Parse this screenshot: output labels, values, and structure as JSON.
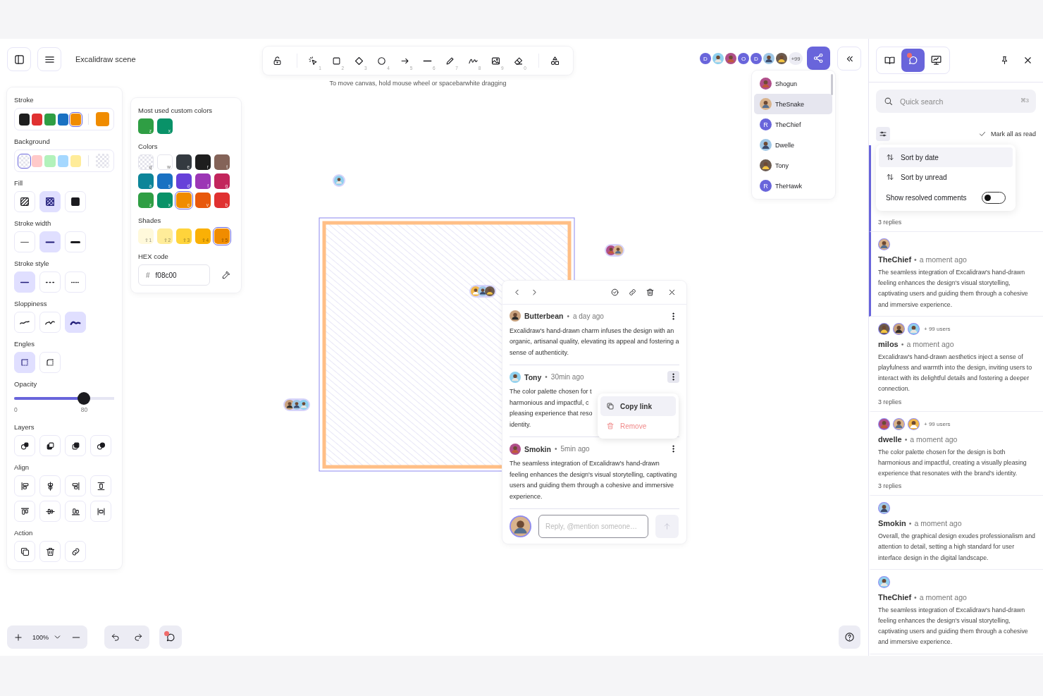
{
  "header": {
    "title": "Excalidraw scene"
  },
  "toolbar": {
    "tools": [
      {
        "shortcut": "1"
      },
      {
        "shortcut": "2"
      },
      {
        "shortcut": "3"
      },
      {
        "shortcut": "4"
      },
      {
        "shortcut": "5"
      },
      {
        "shortcut": "6"
      },
      {
        "shortcut": "7"
      },
      {
        "shortcut": "8"
      },
      {
        "shortcut": "9"
      },
      {
        "shortcut": "0"
      }
    ],
    "hint": "To move canvas, hold mouse wheel or spacebarwhite dragging"
  },
  "collaborators": {
    "avatars": [
      {
        "kind": "letter",
        "letter": "D"
      },
      {
        "kind": "photo"
      },
      {
        "kind": "photo"
      },
      {
        "kind": "letter",
        "letter": "O"
      },
      {
        "kind": "letter",
        "letter": "D"
      },
      {
        "kind": "photo"
      },
      {
        "kind": "photo"
      }
    ],
    "more": "+99",
    "list": [
      {
        "name": "Shogun",
        "kind": "photo",
        "selected": false
      },
      {
        "name": "TheSnake",
        "kind": "photo",
        "selected": true
      },
      {
        "name": "TheChief",
        "kind": "letter",
        "letter": "R",
        "selected": false
      },
      {
        "name": "Dwelle",
        "kind": "photo",
        "selected": false
      },
      {
        "name": "Tony",
        "kind": "photo",
        "selected": false
      },
      {
        "name": "TheHawk",
        "kind": "letter",
        "letter": "R",
        "selected": false
      }
    ]
  },
  "properties": {
    "stroke": {
      "label": "Stroke",
      "swatches": [
        {
          "color": "#1e1e1e",
          "selected": false
        },
        {
          "color": "#e03131",
          "selected": false
        },
        {
          "color": "#2f9e44",
          "selected": false
        },
        {
          "color": "#1971c2",
          "selected": false
        },
        {
          "color": "#f08c00",
          "selected": true
        }
      ],
      "current": {
        "color": "#f08c00"
      }
    },
    "background": {
      "label": "Background",
      "swatches": [
        {
          "kind": "transparent",
          "selected": true
        },
        {
          "kind": "color",
          "color": "#ffc9c9",
          "selected": false
        },
        {
          "kind": "color",
          "color": "#b2f2bb",
          "selected": false
        },
        {
          "kind": "color",
          "color": "#a5d8ff",
          "selected": false
        },
        {
          "kind": "color",
          "color": "#ffec99",
          "selected": false
        }
      ],
      "current": {
        "kind": "transparent"
      }
    },
    "fill": {
      "label": "Fill",
      "options": [
        {
          "selected": false
        },
        {
          "selected": true
        },
        {
          "selected": false
        }
      ]
    },
    "stroke_width": {
      "label": "Stroke width",
      "options": [
        {
          "selected": false
        },
        {
          "selected": true
        },
        {
          "selected": false
        }
      ]
    },
    "stroke_style": {
      "label": "Stroke style",
      "options": [
        {
          "selected": true
        },
        {
          "selected": false
        },
        {
          "selected": false
        }
      ]
    },
    "sloppiness": {
      "label": "Sloppiness",
      "options": [
        {
          "selected": false
        },
        {
          "selected": false
        },
        {
          "selected": true
        }
      ]
    },
    "edges": {
      "label": "Engles",
      "options": [
        {
          "selected": true
        },
        {
          "selected": false
        }
      ]
    },
    "opacity": {
      "label": "Opacity",
      "level": 0.7,
      "min": "0",
      "value": "80"
    },
    "layers": {
      "label": "Layers"
    },
    "align": {
      "label": "Align"
    },
    "action": {
      "label": "Action"
    }
  },
  "color_picker": {
    "custom_title": "Most used custom colors",
    "custom": [
      {
        "color": "#2f9e44",
        "key": "z"
      },
      {
        "color": "#099268",
        "key": "x"
      }
    ],
    "colors_title": "Colors",
    "colors": [
      {
        "kind": "transparent",
        "key": "q",
        "selected": false
      },
      {
        "kind": "color",
        "color": "#ffffff",
        "key": "w",
        "selected": false
      },
      {
        "kind": "color",
        "color": "#343a40",
        "key": "e",
        "selected": false
      },
      {
        "kind": "color",
        "color": "#1e1e1e",
        "key": "r",
        "selected": false
      },
      {
        "kind": "color",
        "color": "#846358",
        "key": "t",
        "selected": false
      },
      {
        "kind": "color",
        "color": "#0c8599",
        "key": "a",
        "selected": false
      },
      {
        "kind": "color",
        "color": "#1971c2",
        "key": "s",
        "selected": false
      },
      {
        "kind": "color",
        "color": "#6741d9",
        "key": "d",
        "selected": false
      },
      {
        "kind": "color",
        "color": "#9c36b5",
        "key": "f",
        "selected": false
      },
      {
        "kind": "color",
        "color": "#c2255c",
        "key": "g",
        "selected": false
      },
      {
        "kind": "color",
        "color": "#2f9e44",
        "key": "z",
        "selected": false
      },
      {
        "kind": "color",
        "color": "#099268",
        "key": "x",
        "selected": false
      },
      {
        "kind": "color",
        "color": "#f08c00",
        "key": "c",
        "selected": true
      },
      {
        "kind": "color",
        "color": "#e8590c",
        "key": "v",
        "selected": false
      },
      {
        "kind": "color",
        "color": "#e03131",
        "key": "b",
        "selected": false
      }
    ],
    "shades_title": "Shades",
    "shades": [
      {
        "color": "#fff9db",
        "key": "⇧1",
        "selected": false
      },
      {
        "color": "#ffec99",
        "key": "⇧2",
        "selected": false
      },
      {
        "color": "#ffd43b",
        "key": "⇧3",
        "selected": false
      },
      {
        "color": "#fab005",
        "key": "⇧4",
        "selected": false
      },
      {
        "color": "#f08c00",
        "key": "⇧5",
        "selected": true
      }
    ],
    "hex_title": "HEX code",
    "hex_prefix": "#",
    "hex_value": "f08c00"
  },
  "comment_popup": {
    "comments": [
      {
        "author": "Butterbean",
        "separator": "•",
        "time": "a day ago",
        "menu_open": false,
        "text": "Excalidraw's hand-drawn charm infuses the design with an organic,  artisanal quality, elevating its appeal and fostering a sense of  authenticity."
      },
      {
        "author": "Tony",
        "separator": "•",
        "time": "30min ago",
        "menu_open": true,
        "lines": [
          "The color palette chosen for t",
          "harmonious and  impactful, c",
          "pleasing experience that reso",
          "identity."
        ]
      },
      {
        "author": "Smokin",
        "separator": "•",
        "time": "5min ago",
        "menu_open": false,
        "text": "The seamless integration of Excalidraw's hand-drawn feeling enhances the  design's visual storytelling, captivating users and guiding them  through a cohesive and immersive experience."
      }
    ],
    "menu": [
      {
        "label": "Copy link",
        "kind": "copy",
        "selected": true
      },
      {
        "label": "Remove",
        "kind": "danger",
        "selected": false
      }
    ],
    "reply": {
      "placeholder": "Reply, @mention someone…",
      "disabled": true
    }
  },
  "bottom_bar": {
    "zoom": "100%",
    "comments_unread": true
  },
  "sidebar": {
    "tabs": [
      {
        "selected": false,
        "unread": false
      },
      {
        "selected": true,
        "unread": true
      },
      {
        "selected": false,
        "unread": false
      }
    ],
    "search": {
      "placeholder": "Quick search",
      "shortcut": "⌘3"
    },
    "mark_all": "Mark all as read",
    "sort_menu": {
      "items": [
        {
          "label": "Sort by date",
          "selected": true
        },
        {
          "label": "Sort by unread",
          "selected": false
        }
      ],
      "toggle": {
        "label": "Show resolved comments",
        "on": false
      }
    },
    "threads": [
      {
        "selected": true,
        "replies": "3 replies"
      },
      {
        "selected": true,
        "avatars": [
          {
            "kind": "photo"
          }
        ],
        "author": "TheChief",
        "separator": "•",
        "time": "a moment ago",
        "text": "The seamless integration of Excalidraw's hand-drawn feeling enhances the  design's visual storytelling, captivating users and guiding them  through a cohesive and immersive experience."
      },
      {
        "selected": false,
        "avatars": [
          {
            "kind": "photo"
          },
          {
            "kind": "photo"
          },
          {
            "kind": "photo"
          }
        ],
        "more": "+ 99 users",
        "author": "milos",
        "separator": "•",
        "time": "a moment ago",
        "text": "Excalidraw's hand-drawn aesthetics inject a sense of playfulness and  warmth into the design, inviting users to interact with its delightful  details and fostering a deeper connection.",
        "replies": "3 replies"
      },
      {
        "selected": false,
        "avatars": [
          {
            "kind": "photo"
          },
          {
            "kind": "photo"
          },
          {
            "kind": "photo"
          }
        ],
        "more": "+ 99 users",
        "author": "dwelle",
        "separator": "•",
        "time": "a moment ago",
        "text": "The color palette chosen for the design is both harmonious and  impactful, creating a visually pleasing experience that resonates with  the brand's identity.",
        "replies": "3 replies"
      },
      {
        "selected": false,
        "avatars": [
          {
            "kind": "photo"
          }
        ],
        "author": "Smokin",
        "separator": "•",
        "time": "a moment ago",
        "text": "Overall, the graphical design exudes professionalism and attention to  detail, setting a high standard for user interface design in the digital  landscape."
      },
      {
        "selected": false,
        "avatars": [
          {
            "kind": "photo"
          }
        ],
        "author": "TheChief",
        "separator": "•",
        "time": "a moment ago",
        "text": "The seamless integration of Excalidraw's hand-drawn feeling enhances the  design's visual storytelling, captivating users and guiding them  through a cohesive and immersive experience."
      }
    ]
  }
}
